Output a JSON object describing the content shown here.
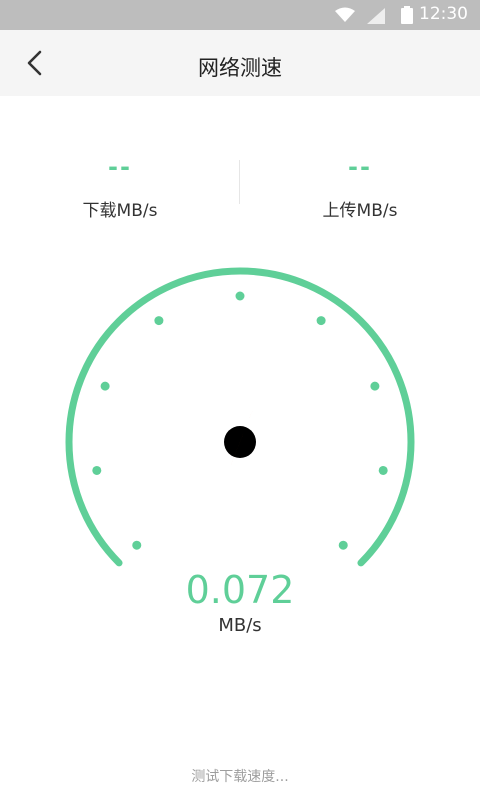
{
  "status_bar": {
    "time": "12:30",
    "icons": [
      "wifi-icon",
      "signal-icon",
      "battery-icon"
    ]
  },
  "nav": {
    "title": "网络测速",
    "back_icon": "back-chevron-icon"
  },
  "download": {
    "value": "--",
    "label": "下载MB/s"
  },
  "upload": {
    "value": "--",
    "label": "上传MB/s"
  },
  "gauge": {
    "speed_value": "0.072",
    "unit": "MB/s",
    "needle_fraction": 0.58,
    "accent_color": "#5fcf98",
    "needle_color": "#ff5a0a"
  },
  "footer": {
    "status_text": "测试下载速度..."
  }
}
